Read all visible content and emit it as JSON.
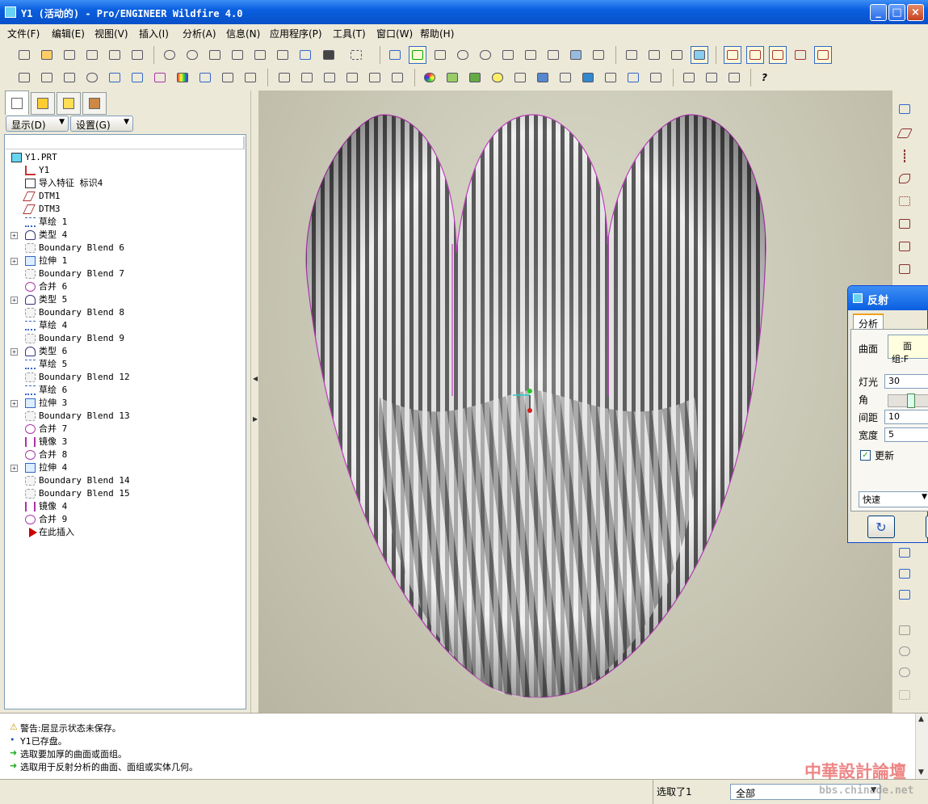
{
  "window": {
    "title": "Y1 (活动的) - Pro/ENGINEER Wildfire 4.0",
    "min": "_",
    "max": "□",
    "close": "×"
  },
  "menu": [
    "文件(F)",
    "编辑(E)",
    "视图(V)",
    "插入(I)",
    "分析(A)",
    "信息(N)",
    "应用程序(P)",
    "工具(T)",
    "窗口(W)",
    "帮助(H)"
  ],
  "panel": {
    "show_dropdown": "显示(D)",
    "settings_dropdown": "设置(G)",
    "tree": [
      {
        "label": "Y1.PRT",
        "icon": "part-icon",
        "expand": false
      },
      {
        "label": "Y1",
        "icon": "csys-icon",
        "expand": false
      },
      {
        "label": "导入特征 标识4",
        "icon": "import-feature-icon",
        "expand": false
      },
      {
        "label": "DTM1",
        "icon": "datum-plane-icon",
        "expand": false
      },
      {
        "label": "DTM3",
        "icon": "datum-plane-icon",
        "expand": false
      },
      {
        "label": "草绘 1",
        "icon": "sketch-icon",
        "expand": false
      },
      {
        "label": "类型 4",
        "icon": "group-icon",
        "expand": true
      },
      {
        "label": "Boundary Blend 6",
        "icon": "boundary-blend-icon",
        "expand": false
      },
      {
        "label": "拉伸 1",
        "icon": "extrude-icon",
        "expand": true
      },
      {
        "label": "Boundary Blend 7",
        "icon": "boundary-blend-icon",
        "expand": false
      },
      {
        "label": "合并 6",
        "icon": "merge-icon",
        "expand": false
      },
      {
        "label": "类型 5",
        "icon": "group-icon",
        "expand": true
      },
      {
        "label": "Boundary Blend 8",
        "icon": "boundary-blend-icon",
        "expand": false
      },
      {
        "label": "草绘 4",
        "icon": "sketch-icon",
        "expand": false
      },
      {
        "label": "Boundary Blend 9",
        "icon": "boundary-blend-icon",
        "expand": false
      },
      {
        "label": "类型 6",
        "icon": "group-icon",
        "expand": true
      },
      {
        "label": "草绘 5",
        "icon": "sketch-icon",
        "expand": false
      },
      {
        "label": "Boundary Blend 12",
        "icon": "boundary-blend-icon",
        "expand": false
      },
      {
        "label": "草绘 6",
        "icon": "sketch-icon",
        "expand": false
      },
      {
        "label": "拉伸 3",
        "icon": "extrude-icon",
        "expand": true
      },
      {
        "label": "Boundary Blend 13",
        "icon": "boundary-blend-icon",
        "expand": false
      },
      {
        "label": "合并 7",
        "icon": "merge-icon",
        "expand": false
      },
      {
        "label": "镜像 3",
        "icon": "mirror-icon",
        "expand": false
      },
      {
        "label": "合并 8",
        "icon": "merge-icon",
        "expand": false
      },
      {
        "label": "拉伸 4",
        "icon": "extrude-icon",
        "expand": true
      },
      {
        "label": "Boundary Blend 14",
        "icon": "boundary-blend-icon",
        "expand": false
      },
      {
        "label": "Boundary Blend 15",
        "icon": "boundary-blend-icon",
        "expand": false
      },
      {
        "label": "镜像 4",
        "icon": "mirror-icon",
        "expand": false
      },
      {
        "label": "合并 9",
        "icon": "merge-icon",
        "expand": false
      },
      {
        "label": "在此插入",
        "icon": "insert-here-arrow-icon",
        "expand": false
      }
    ]
  },
  "dialog": {
    "title": "反射",
    "tab": "分析",
    "surface_label": "曲面",
    "surface_value": "面组:F",
    "light_label": "灯光",
    "light_value": "30",
    "angle_label": "角",
    "angle_fraction": 0.55,
    "spacing_label": "间距",
    "spacing_value": "10",
    "width_label": "宽度",
    "width_value": "5",
    "update_label": "更新",
    "update_checked": true,
    "mode_value": "快速"
  },
  "messages": [
    {
      "icon": "warning-icon",
      "text": "警告:层显示状态未保存。"
    },
    {
      "icon": "bullet-icon",
      "text": "Y1已存盘。"
    },
    {
      "icon": "prompt-arrow-icon",
      "text": "选取要加厚的曲面或面组。"
    },
    {
      "icon": "prompt-arrow-icon",
      "text": "选取用于反射分析的曲面、面组或实体几何。"
    }
  ],
  "status": {
    "selected": "选取了1",
    "filter": "全部"
  },
  "watermark": {
    "line1": "中華設計論壇",
    "line2": "bbs.chinade.net"
  },
  "colors": {
    "title_blue": "#0a5fe0",
    "viewport_bg": "#d0cfbd",
    "stripe_dark": "#555555",
    "stripe_light": "#f2f2f2",
    "edge_magenta": "#c040c0",
    "watermark_red": "#e02020"
  }
}
